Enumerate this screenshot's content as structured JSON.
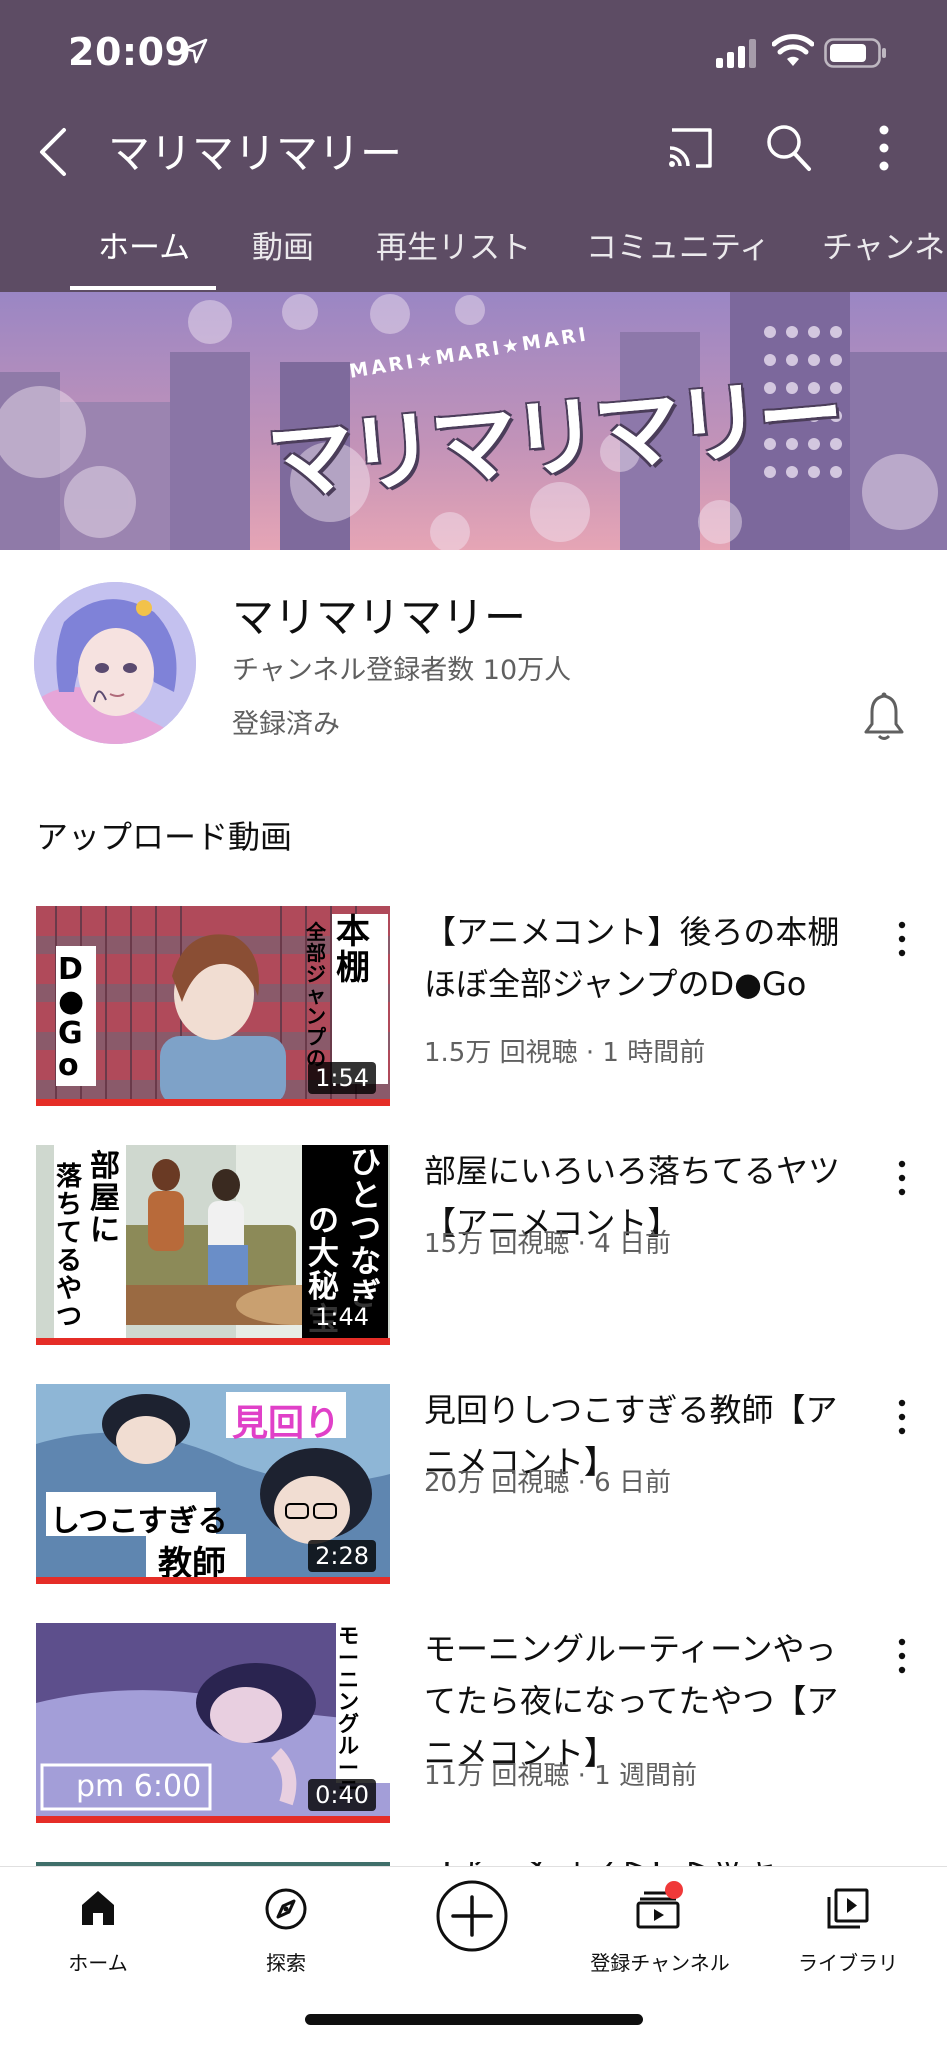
{
  "status_bar": {
    "time": "20:09"
  },
  "app_bar": {
    "title": "マリマリマリー"
  },
  "tabs": [
    {
      "label": "ホーム",
      "active": true
    },
    {
      "label": "動画"
    },
    {
      "label": "再生リスト"
    },
    {
      "label": "コミュニティ"
    },
    {
      "label": "チャンネ"
    }
  ],
  "banner": {
    "logo_sub": "MARI★MARI★MARI",
    "logo_text": "マリマリマリー"
  },
  "channel": {
    "name": "マリマリマリー",
    "subscribers": "チャンネル登録者数 10万人",
    "status": "登録済み"
  },
  "section_title": "アップロード動画",
  "videos": [
    {
      "title": "【アニメコント】後ろの本棚ほぼ全部ジャンプのD●Go",
      "meta": "1.5万 回視聴 · 1 時間前",
      "duration": "1:54",
      "thumb_text_left": "D●Go",
      "thumb_text_right": "本棚",
      "thumb_text_right_sub": "全部ジャンプの"
    },
    {
      "title": "部屋にいろいろ落ちてるヤツ【アニメコント】",
      "meta": "15万 回視聴 · 4 日前",
      "duration": "1:44",
      "thumb_text_left": "部屋に",
      "thumb_text_left_sub": "落ちてるやつ",
      "thumb_text_right": "ひとつなぎ",
      "thumb_text_right_sub": "の大秘宝"
    },
    {
      "title": "見回りしつこすぎる教師【アニメコント】",
      "meta": "20万 回視聴 · 6 日前",
      "duration": "2:28",
      "thumb_text_top": "見回り",
      "thumb_text_mid": "しつこすぎる",
      "thumb_text_bottom": "教師"
    },
    {
      "title": "モーニングルーティーンやってたら夜になってたやつ【アニメコント】",
      "meta": "11万 回視聴 · 1 週間前",
      "duration": "0:40",
      "thumb_text_clock": "pm 6:00",
      "thumb_text_right": "モーニングルーテ"
    },
    {
      "title": "【アニメコント】ドッキ",
      "meta": ""
    }
  ],
  "bottom_nav": [
    {
      "label": "ホーム",
      "icon": "home-icon",
      "active": true
    },
    {
      "label": "探索",
      "icon": "compass-icon"
    },
    {
      "label": "",
      "icon": "create-plus-icon"
    },
    {
      "label": "登録チャンネル",
      "icon": "subscriptions-icon",
      "badge": true
    },
    {
      "label": "ライブラリ",
      "icon": "library-icon"
    }
  ],
  "colors": {
    "header_bg": "#5d4c64",
    "accent_red": "#e52d27",
    "badge_red": "#f03939"
  }
}
